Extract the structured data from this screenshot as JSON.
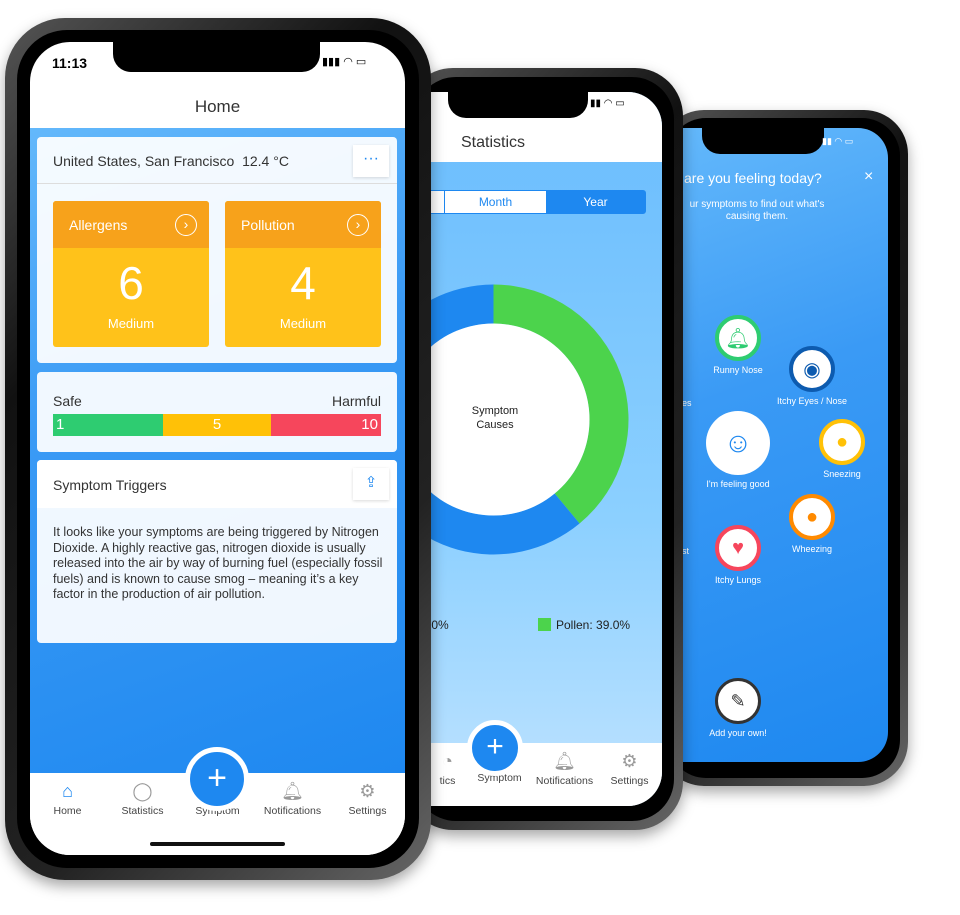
{
  "phone1": {
    "status": {
      "time": "11:13"
    },
    "title": "Home",
    "location": "United States, San Francisco  12.4 °C",
    "tiles": [
      {
        "label": "Allergens",
        "value": "6",
        "level": "Medium"
      },
      {
        "label": "Pollution",
        "value": "4",
        "level": "Medium"
      }
    ],
    "scale": {
      "low_label": "Safe",
      "high_label": "Harmful",
      "segments": [
        "1",
        "5",
        "10"
      ],
      "colors": [
        "#2ECC71",
        "#FFC107",
        "#F6465C"
      ]
    },
    "triggers": {
      "title": "Symptom Triggers",
      "text": "It looks like your symptoms are being triggered by Nitrogen Dioxide. A highly reactive gas, nitrogen dioxide is usually released into the air by way of burning fuel (especially fossil fuels) and is known to cause smog – meaning it’s a key factor in the production of air pollution."
    },
    "tabs": [
      "Home",
      "Statistics",
      "Symptom",
      "Notifications",
      "Settings"
    ]
  },
  "phone2": {
    "title": "Statistics",
    "segments": [
      "Month",
      "Year"
    ],
    "donut_label": "Symptom Causes",
    "chart_data": {
      "type": "pie",
      "values": [
        39.0,
        61.0
      ],
      "colors": [
        "#4CD34C",
        "#1E88F0"
      ],
      "legend": [
        "Pollen: 39.0%"
      ]
    },
    "legend_partial": ".0%",
    "tabs": [
      "tics",
      "Symptom",
      "Notifications",
      "Settings"
    ]
  },
  "phone3": {
    "title": "are you feeling today?",
    "subtitle": "ur symptoms to find out what's causing them.",
    "symptoms": [
      {
        "label": "Runny Nose",
        "color": "#2ECC71"
      },
      {
        "label": "Itchy Eyes / Nose",
        "color": "#0D5BAF"
      },
      {
        "label": "I'm feeling good",
        "color": "#FFFFFF"
      },
      {
        "label": "Sneezing",
        "color": "#FFC107"
      },
      {
        "label": "Wheezing",
        "color": "#FF8A00"
      },
      {
        "label": "Itchy Lungs",
        "color": "#F6465C"
      },
      {
        "label": "es",
        "color": "#1ABC9C"
      },
      {
        "label": "st",
        "color": "#9B59B6"
      }
    ],
    "add_label": "Add your own!"
  }
}
